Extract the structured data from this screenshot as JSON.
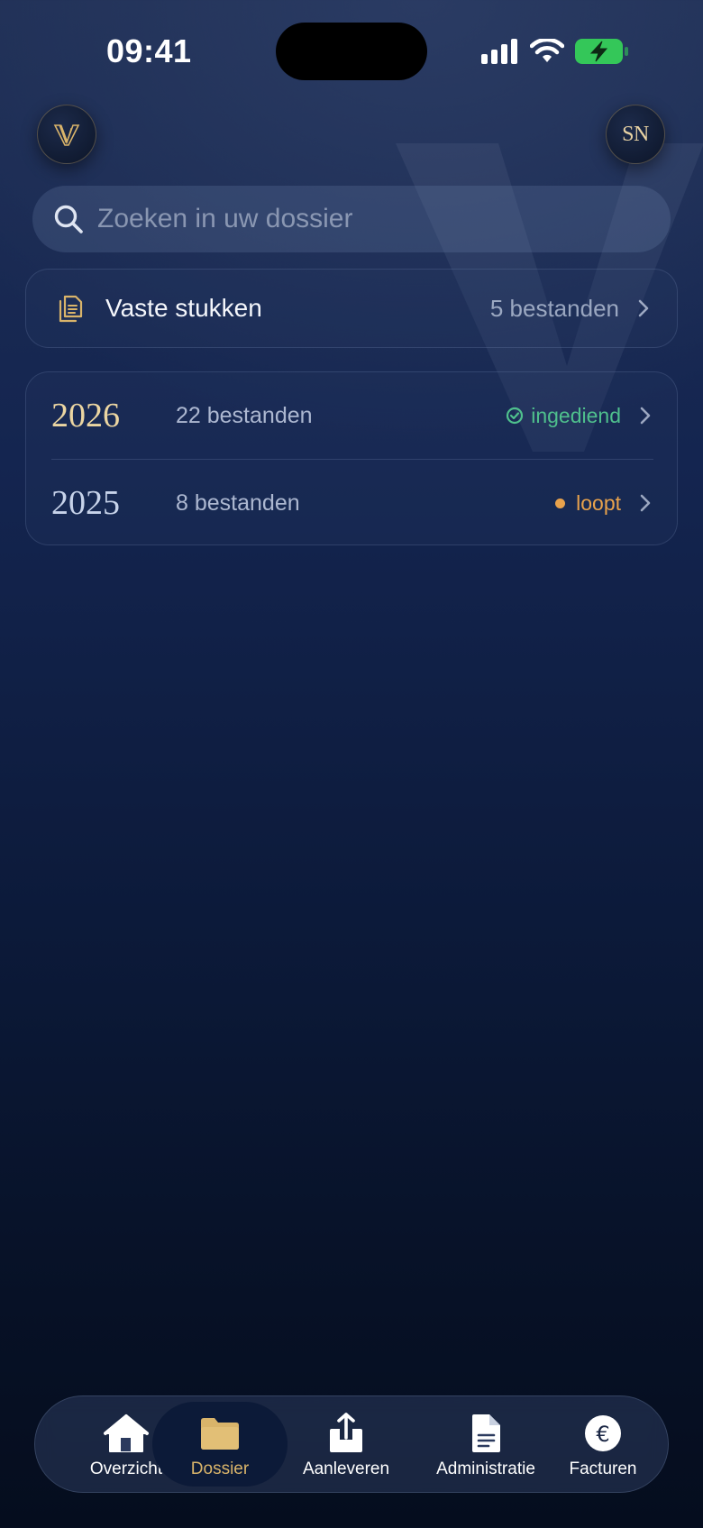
{
  "status_bar": {
    "time": "09:41"
  },
  "header": {
    "logo_icon": "v-monogram-logo-icon",
    "avatar_initials": "SN"
  },
  "search": {
    "placeholder": "Zoeken in uw dossier",
    "icon": "search-icon"
  },
  "vaste_stukken": {
    "title": "Vaste stukken",
    "count": "5 bestanden",
    "icon": "document-icon"
  },
  "years": [
    {
      "year": "2026",
      "files": "22 bestanden",
      "status": "ingediend",
      "status_type": "submitted",
      "color": "#4fc08d"
    },
    {
      "year": "2025",
      "files": "8 bestanden",
      "status": "loopt",
      "status_type": "in-progress",
      "color": "#e8a24c"
    }
  ],
  "tabs": [
    {
      "label": "Overzicht",
      "icon": "home-icon",
      "active": false
    },
    {
      "label": "Dossier",
      "icon": "folder-icon",
      "active": true
    },
    {
      "label": "Aanleveren",
      "icon": "upload-icon",
      "active": false
    },
    {
      "label": "Administratie",
      "icon": "document-icon",
      "active": false
    },
    {
      "label": "Facturen",
      "icon": "euro-icon",
      "active": false
    }
  ],
  "colors": {
    "accent_gold": "#d9b46a",
    "status_green": "#4fc08d",
    "status_orange": "#e8a24c",
    "background_top": "#1f2f55",
    "background_bottom": "#050d1e"
  }
}
